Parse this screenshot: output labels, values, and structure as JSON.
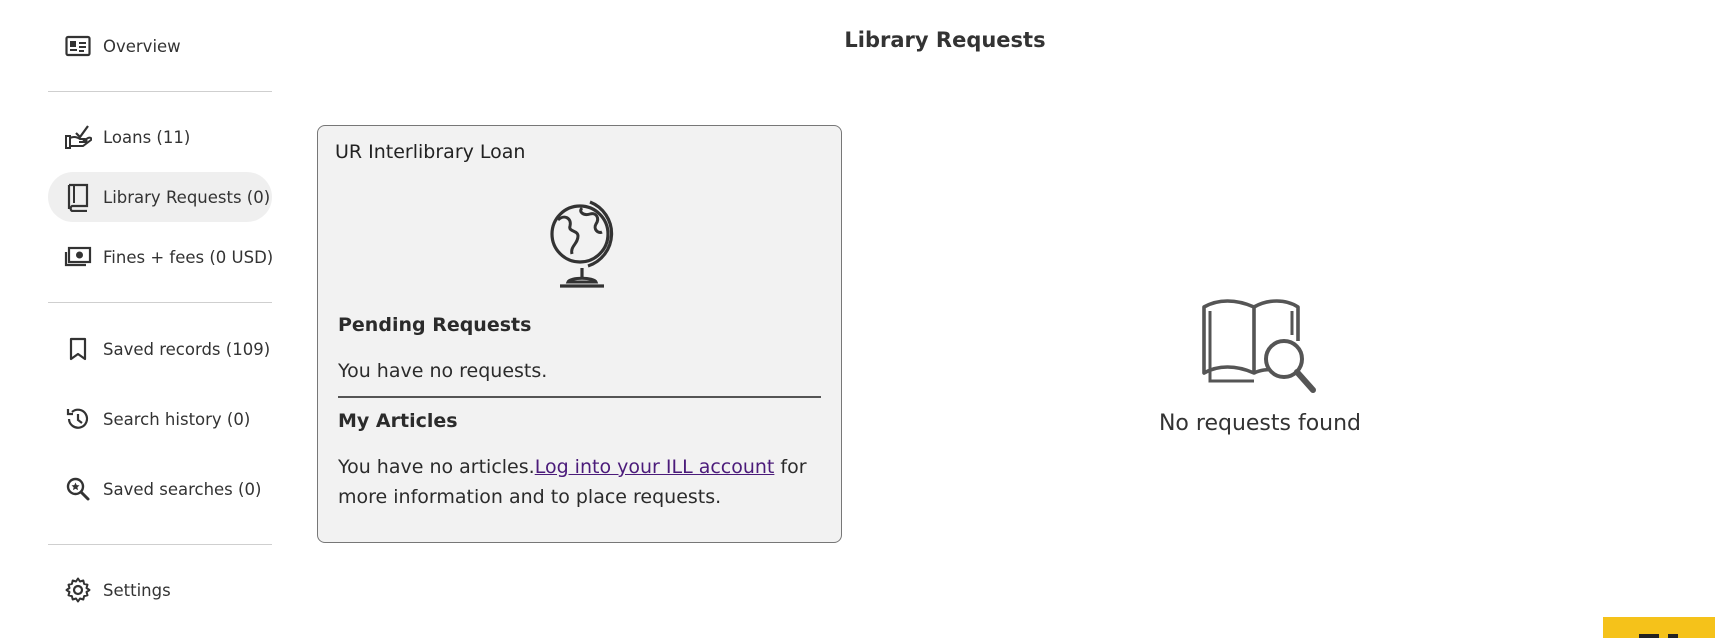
{
  "sidebar": {
    "items": [
      {
        "label": "Overview",
        "icon": "id-card-icon"
      },
      {
        "label": "Loans (11)",
        "icon": "hand-check-icon"
      },
      {
        "label": "Library Requests (0)",
        "icon": "book-icon",
        "active": true
      },
      {
        "label": "Fines + fees (0 USD)",
        "icon": "money-icon"
      },
      {
        "label": "Saved records (109)",
        "icon": "bookmark-icon"
      },
      {
        "label": "Search history (0)",
        "icon": "history-icon"
      },
      {
        "label": "Saved searches (0)",
        "icon": "search-saved-icon"
      },
      {
        "label": "Settings",
        "icon": "gear-icon"
      }
    ]
  },
  "main": {
    "title": "Library Requests",
    "ill_card": {
      "title": "UR Interlibrary Loan",
      "pending_heading": "Pending Requests",
      "pending_text": "You have no requests.",
      "articles_heading": "My Articles",
      "articles_text": "You have no articles.",
      "articles_link": "Log into your ILL account",
      "articles_suffix": " for more information and to place requests."
    },
    "empty_state": {
      "text": "No requests found"
    }
  },
  "colors": {
    "active_bg": "#efefef",
    "link": "#4b1b7a",
    "card_bg": "#f2f2f2",
    "feedback_tab": "#f5c21a"
  }
}
